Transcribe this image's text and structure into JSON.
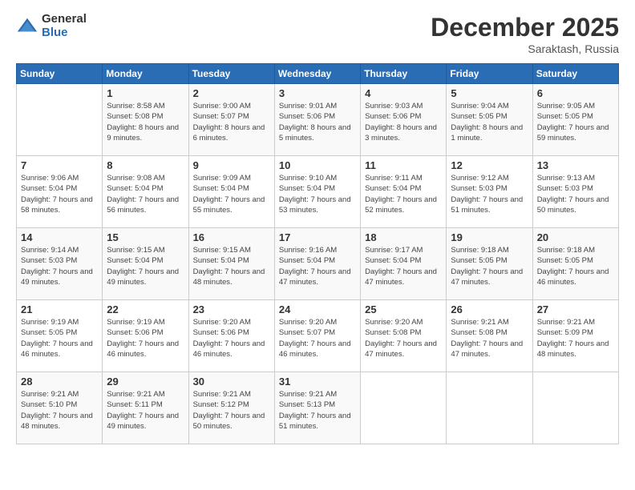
{
  "logo": {
    "general": "General",
    "blue": "Blue"
  },
  "title": "December 2025",
  "subtitle": "Saraktash, Russia",
  "headers": [
    "Sunday",
    "Monday",
    "Tuesday",
    "Wednesday",
    "Thursday",
    "Friday",
    "Saturday"
  ],
  "weeks": [
    [
      {
        "day": "",
        "sunrise": "",
        "sunset": "",
        "daylight": ""
      },
      {
        "day": "1",
        "sunrise": "Sunrise: 8:58 AM",
        "sunset": "Sunset: 5:08 PM",
        "daylight": "Daylight: 8 hours and 9 minutes."
      },
      {
        "day": "2",
        "sunrise": "Sunrise: 9:00 AM",
        "sunset": "Sunset: 5:07 PM",
        "daylight": "Daylight: 8 hours and 6 minutes."
      },
      {
        "day": "3",
        "sunrise": "Sunrise: 9:01 AM",
        "sunset": "Sunset: 5:06 PM",
        "daylight": "Daylight: 8 hours and 5 minutes."
      },
      {
        "day": "4",
        "sunrise": "Sunrise: 9:03 AM",
        "sunset": "Sunset: 5:06 PM",
        "daylight": "Daylight: 8 hours and 3 minutes."
      },
      {
        "day": "5",
        "sunrise": "Sunrise: 9:04 AM",
        "sunset": "Sunset: 5:05 PM",
        "daylight": "Daylight: 8 hours and 1 minute."
      },
      {
        "day": "6",
        "sunrise": "Sunrise: 9:05 AM",
        "sunset": "Sunset: 5:05 PM",
        "daylight": "Daylight: 7 hours and 59 minutes."
      }
    ],
    [
      {
        "day": "7",
        "sunrise": "Sunrise: 9:06 AM",
        "sunset": "Sunset: 5:04 PM",
        "daylight": "Daylight: 7 hours and 58 minutes."
      },
      {
        "day": "8",
        "sunrise": "Sunrise: 9:08 AM",
        "sunset": "Sunset: 5:04 PM",
        "daylight": "Daylight: 7 hours and 56 minutes."
      },
      {
        "day": "9",
        "sunrise": "Sunrise: 9:09 AM",
        "sunset": "Sunset: 5:04 PM",
        "daylight": "Daylight: 7 hours and 55 minutes."
      },
      {
        "day": "10",
        "sunrise": "Sunrise: 9:10 AM",
        "sunset": "Sunset: 5:04 PM",
        "daylight": "Daylight: 7 hours and 53 minutes."
      },
      {
        "day": "11",
        "sunrise": "Sunrise: 9:11 AM",
        "sunset": "Sunset: 5:04 PM",
        "daylight": "Daylight: 7 hours and 52 minutes."
      },
      {
        "day": "12",
        "sunrise": "Sunrise: 9:12 AM",
        "sunset": "Sunset: 5:03 PM",
        "daylight": "Daylight: 7 hours and 51 minutes."
      },
      {
        "day": "13",
        "sunrise": "Sunrise: 9:13 AM",
        "sunset": "Sunset: 5:03 PM",
        "daylight": "Daylight: 7 hours and 50 minutes."
      }
    ],
    [
      {
        "day": "14",
        "sunrise": "Sunrise: 9:14 AM",
        "sunset": "Sunset: 5:03 PM",
        "daylight": "Daylight: 7 hours and 49 minutes."
      },
      {
        "day": "15",
        "sunrise": "Sunrise: 9:15 AM",
        "sunset": "Sunset: 5:04 PM",
        "daylight": "Daylight: 7 hours and 49 minutes."
      },
      {
        "day": "16",
        "sunrise": "Sunrise: 9:15 AM",
        "sunset": "Sunset: 5:04 PM",
        "daylight": "Daylight: 7 hours and 48 minutes."
      },
      {
        "day": "17",
        "sunrise": "Sunrise: 9:16 AM",
        "sunset": "Sunset: 5:04 PM",
        "daylight": "Daylight: 7 hours and 47 minutes."
      },
      {
        "day": "18",
        "sunrise": "Sunrise: 9:17 AM",
        "sunset": "Sunset: 5:04 PM",
        "daylight": "Daylight: 7 hours and 47 minutes."
      },
      {
        "day": "19",
        "sunrise": "Sunrise: 9:18 AM",
        "sunset": "Sunset: 5:05 PM",
        "daylight": "Daylight: 7 hours and 47 minutes."
      },
      {
        "day": "20",
        "sunrise": "Sunrise: 9:18 AM",
        "sunset": "Sunset: 5:05 PM",
        "daylight": "Daylight: 7 hours and 46 minutes."
      }
    ],
    [
      {
        "day": "21",
        "sunrise": "Sunrise: 9:19 AM",
        "sunset": "Sunset: 5:05 PM",
        "daylight": "Daylight: 7 hours and 46 minutes."
      },
      {
        "day": "22",
        "sunrise": "Sunrise: 9:19 AM",
        "sunset": "Sunset: 5:06 PM",
        "daylight": "Daylight: 7 hours and 46 minutes."
      },
      {
        "day": "23",
        "sunrise": "Sunrise: 9:20 AM",
        "sunset": "Sunset: 5:06 PM",
        "daylight": "Daylight: 7 hours and 46 minutes."
      },
      {
        "day": "24",
        "sunrise": "Sunrise: 9:20 AM",
        "sunset": "Sunset: 5:07 PM",
        "daylight": "Daylight: 7 hours and 46 minutes."
      },
      {
        "day": "25",
        "sunrise": "Sunrise: 9:20 AM",
        "sunset": "Sunset: 5:08 PM",
        "daylight": "Daylight: 7 hours and 47 minutes."
      },
      {
        "day": "26",
        "sunrise": "Sunrise: 9:21 AM",
        "sunset": "Sunset: 5:08 PM",
        "daylight": "Daylight: 7 hours and 47 minutes."
      },
      {
        "day": "27",
        "sunrise": "Sunrise: 9:21 AM",
        "sunset": "Sunset: 5:09 PM",
        "daylight": "Daylight: 7 hours and 48 minutes."
      }
    ],
    [
      {
        "day": "28",
        "sunrise": "Sunrise: 9:21 AM",
        "sunset": "Sunset: 5:10 PM",
        "daylight": "Daylight: 7 hours and 48 minutes."
      },
      {
        "day": "29",
        "sunrise": "Sunrise: 9:21 AM",
        "sunset": "Sunset: 5:11 PM",
        "daylight": "Daylight: 7 hours and 49 minutes."
      },
      {
        "day": "30",
        "sunrise": "Sunrise: 9:21 AM",
        "sunset": "Sunset: 5:12 PM",
        "daylight": "Daylight: 7 hours and 50 minutes."
      },
      {
        "day": "31",
        "sunrise": "Sunrise: 9:21 AM",
        "sunset": "Sunset: 5:13 PM",
        "daylight": "Daylight: 7 hours and 51 minutes."
      },
      {
        "day": "",
        "sunrise": "",
        "sunset": "",
        "daylight": ""
      },
      {
        "day": "",
        "sunrise": "",
        "sunset": "",
        "daylight": ""
      },
      {
        "day": "",
        "sunrise": "",
        "sunset": "",
        "daylight": ""
      }
    ]
  ]
}
